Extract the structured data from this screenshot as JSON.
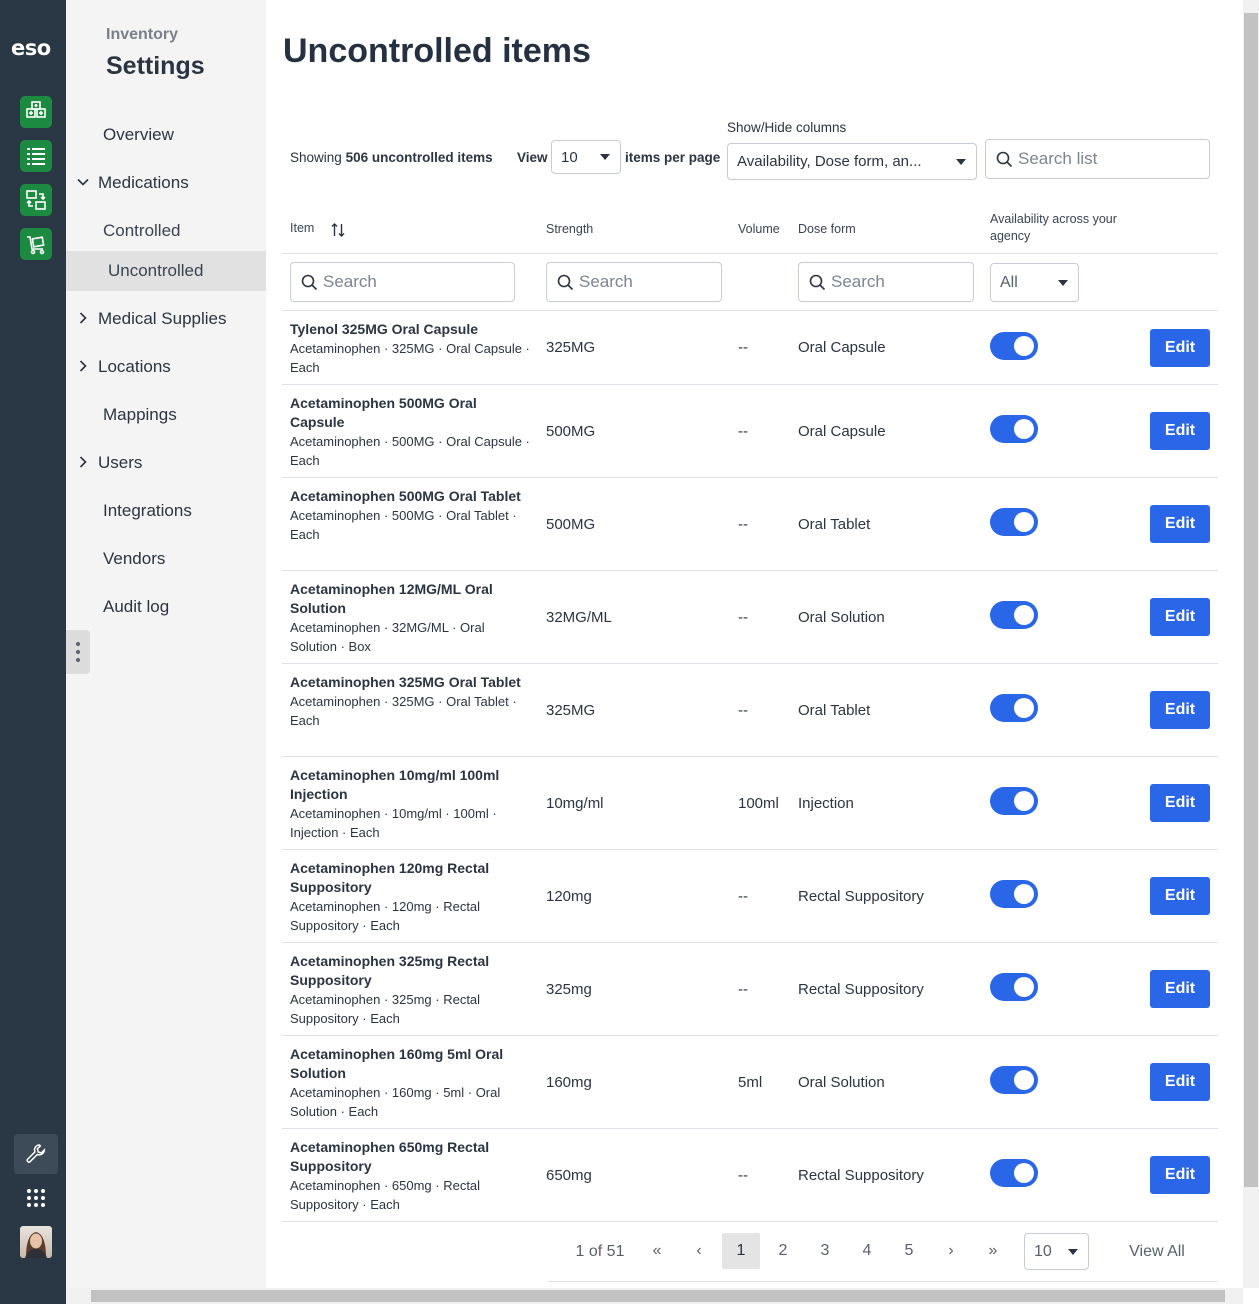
{
  "brand": {
    "logo_text": "eso",
    "accent": "#2a66e8",
    "rail_bg": "#2a3744",
    "module_green": "#1d8a41"
  },
  "rail": {
    "top_icons": [
      "inventory-grid-icon",
      "list-icon",
      "transfer-icon",
      "cart-icon"
    ],
    "bottom_icons": [
      "wrench-icon",
      "apps-grid-icon",
      "user-avatar"
    ]
  },
  "sidebar": {
    "supertitle": "Inventory",
    "title": "Settings",
    "items": [
      {
        "label": "Overview"
      },
      {
        "label": "Medications"
      },
      {
        "label": "Controlled"
      },
      {
        "label": "Uncontrolled"
      },
      {
        "label": "Medical Supplies"
      },
      {
        "label": "Locations"
      },
      {
        "label": "Mappings"
      },
      {
        "label": "Users"
      },
      {
        "label": "Integrations"
      },
      {
        "label": "Vendors"
      },
      {
        "label": "Audit log"
      }
    ]
  },
  "page": {
    "title": "Uncontrolled items",
    "showing_prefix": "Showing",
    "showing_count": "506 uncontrolled items",
    "view_label": "View",
    "per_page_value": "10",
    "per_page_suffix": "items per page",
    "columns_label": "Show/Hide columns",
    "columns_value": "Availability, Dose form, an...",
    "search_placeholder": "Search list"
  },
  "table": {
    "headers": {
      "item": "Item",
      "strength": "Strength",
      "volume": "Volume",
      "dose_form": "Dose form",
      "availability": "Availability across your agency"
    },
    "filter_placeholder": "Search",
    "availability_filter": "All",
    "edit_label": "Edit",
    "rows": [
      {
        "name": "Tylenol 325MG Oral Capsule",
        "desc": "Acetaminophen · 325MG · Oral Capsule · Each",
        "strength": "325MG",
        "volume": "--",
        "dose_form": "Oral Capsule",
        "available": true
      },
      {
        "name": "Acetaminophen 500MG Oral Capsule",
        "desc": "Acetaminophen · 500MG · Oral Capsule · Each",
        "strength": "500MG",
        "volume": "--",
        "dose_form": "Oral Capsule",
        "available": true
      },
      {
        "name": "Acetaminophen 500MG Oral Tablet",
        "desc": "Acetaminophen · 500MG · Oral Tablet · Each",
        "strength": "500MG",
        "volume": "--",
        "dose_form": "Oral Tablet",
        "available": true
      },
      {
        "name": "Acetaminophen 12MG/ML Oral Solution",
        "desc": "Acetaminophen · 32MG/ML · Oral Solution · Box",
        "strength": "32MG/ML",
        "volume": "--",
        "dose_form": "Oral Solution",
        "available": true
      },
      {
        "name": "Acetaminophen 325MG Oral Tablet",
        "desc": "Acetaminophen · 325MG · Oral Tablet · Each",
        "strength": "325MG",
        "volume": "--",
        "dose_form": "Oral Tablet",
        "available": true
      },
      {
        "name": "Acetaminophen 10mg/ml 100ml Injection",
        "desc": "Acetaminophen · 10mg/ml · 100ml · Injection · Each",
        "strength": "10mg/ml",
        "volume": "100ml",
        "dose_form": "Injection",
        "available": true
      },
      {
        "name": "Acetaminophen 120mg Rectal Suppository",
        "desc": "Acetaminophen · 120mg · Rectal Suppository · Each",
        "strength": "120mg",
        "volume": "--",
        "dose_form": "Rectal Suppository",
        "available": true
      },
      {
        "name": "Acetaminophen 325mg Rectal Suppository",
        "desc": "Acetaminophen · 325mg · Rectal Suppository · Each",
        "strength": "325mg",
        "volume": "--",
        "dose_form": "Rectal Suppository",
        "available": true
      },
      {
        "name": "Acetaminophen 160mg 5ml Oral Solution",
        "desc": "Acetaminophen · 160mg · 5ml · Oral Solution · Each",
        "strength": "160mg",
        "volume": "5ml",
        "dose_form": "Oral Solution",
        "available": true
      },
      {
        "name": "Acetaminophen 650mg Rectal Suppository",
        "desc": "Acetaminophen · 650mg · Rectal Suppository · Each",
        "strength": "650mg",
        "volume": "--",
        "dose_form": "Rectal Suppository",
        "available": true
      }
    ]
  },
  "pagination": {
    "summary": "1 of 51",
    "first": "«",
    "prev": "‹",
    "pages": [
      "1",
      "2",
      "3",
      "4",
      "5"
    ],
    "current": "1",
    "next": "›",
    "last": "»",
    "page_size": "10",
    "view_all": "View All"
  }
}
